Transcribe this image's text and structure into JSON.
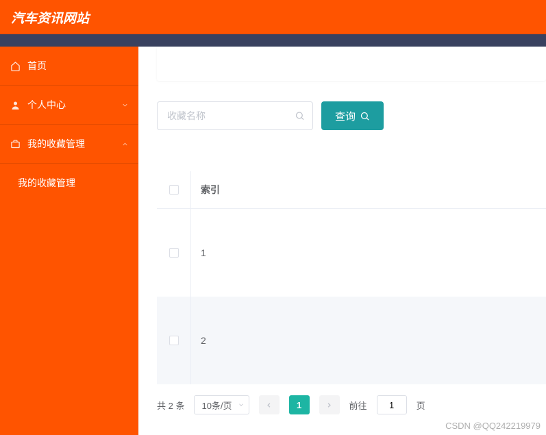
{
  "header": {
    "title": "汽车资讯网站"
  },
  "sidebar": {
    "home": "首页",
    "personal": "个人中心",
    "favorites": "我的收藏管理",
    "favorites_sub": "我的收藏管理"
  },
  "search": {
    "placeholder": "收藏名称",
    "query_btn": "查询"
  },
  "table": {
    "col_index": "索引",
    "rows": [
      {
        "index": "1"
      },
      {
        "index": "2"
      }
    ]
  },
  "pagination": {
    "total_text": "共 2 条",
    "page_size": "10条/页",
    "current": "1",
    "goto_label": "前往",
    "goto_value": "1",
    "page_unit": "页"
  },
  "watermark": "CSDN @QQ242219979"
}
